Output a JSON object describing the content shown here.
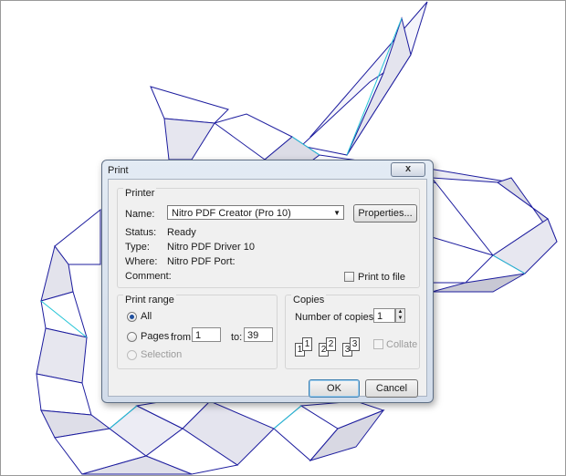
{
  "dialog": {
    "title": "Print",
    "close_label": "x",
    "printer": {
      "group_label": "Printer",
      "name_label": "Name:",
      "name_value": "Nitro PDF Creator (Pro 10)",
      "properties_label": "Properties...",
      "status_label": "Status:",
      "status_value": "Ready",
      "type_label": "Type:",
      "type_value": "Nitro PDF Driver 10",
      "where_label": "Where:",
      "where_value": "Nitro PDF Port:",
      "comment_label": "Comment:",
      "print_to_file_label": "Print to file",
      "print_to_file_checked": false
    },
    "print_range": {
      "group_label": "Print range",
      "all_label": "All",
      "pages_label": "Pages",
      "from_label": "from:",
      "from_value": "1",
      "to_label": "to:",
      "to_value": "39",
      "selection_label": "Selection",
      "selected": "All"
    },
    "copies": {
      "group_label": "Copies",
      "number_label": "Number of copies:",
      "number_value": "1",
      "collate_label": "Collate",
      "collate_enabled": false,
      "page_numbers": [
        "1",
        "1",
        "2",
        "2",
        "3",
        "3"
      ]
    },
    "ok_label": "OK",
    "cancel_label": "Cancel"
  },
  "background": {
    "description_icon": "wireframe-model-render",
    "edge_color": "#1c1c9e",
    "accent_edge_color": "#22c4d6"
  }
}
